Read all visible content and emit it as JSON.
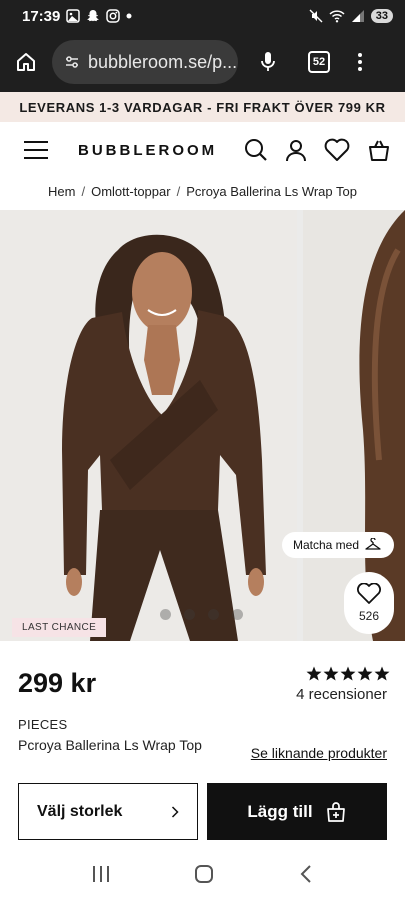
{
  "status_bar": {
    "time": "17:39",
    "battery": "33"
  },
  "browser": {
    "url": "bubbleroom.se/p...",
    "tab_count": "52"
  },
  "promo": {
    "text": "LEVERANS 1-3 VARDAGAR - FRI FRAKT ÖVER 799 KR"
  },
  "header": {
    "logo": "BUBBLEROOM"
  },
  "breadcrumb": {
    "items": [
      "Hem",
      "Omlott-toppar",
      "Pcroya Ballerina Ls Wrap Top"
    ],
    "separator": "/"
  },
  "gallery": {
    "badge": "LAST CHANCE",
    "match_label": "Matcha med",
    "favorite_count": "526",
    "dot_count": 4,
    "garment_color": "#4a3022"
  },
  "product": {
    "price": "299 kr",
    "rating": 5,
    "reviews": "4 recensioner",
    "brand": "PIECES",
    "name": "Pcroya Ballerina Ls Wrap Top",
    "similar_link": "Se liknande produkter"
  },
  "actions": {
    "size_label": "Välj storlek",
    "add_label": "Lägg till"
  },
  "colors": {
    "promo_bg": "#f4e9e4",
    "badge_bg": "#f6e3e6",
    "primary": "#111111"
  }
}
